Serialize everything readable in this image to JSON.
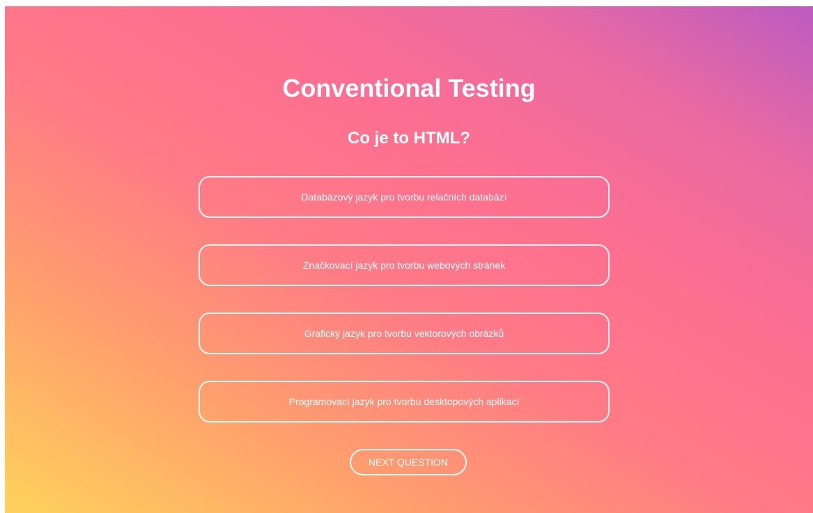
{
  "quiz": {
    "title": "Conventional Testing",
    "question": "Co je to HTML?",
    "answers": [
      {
        "label": "Databázový jazyk pro tvorbu relačních databází"
      },
      {
        "label": "Značkovací jazyk pro tvorbu webových stránek"
      },
      {
        "label": "Grafický jazyk pro tvorbu vektorových obrázků"
      },
      {
        "label": "Programovací jazyk pro tvorbu desktopových aplikací"
      }
    ],
    "next_label": "NEXT QUESTION"
  },
  "colors": {
    "gradient_start": "#ffd25c",
    "gradient_mid": "#ff7b86",
    "gradient_end": "#bc5bc0",
    "text": "#ffffff",
    "border": "#ffffff"
  }
}
